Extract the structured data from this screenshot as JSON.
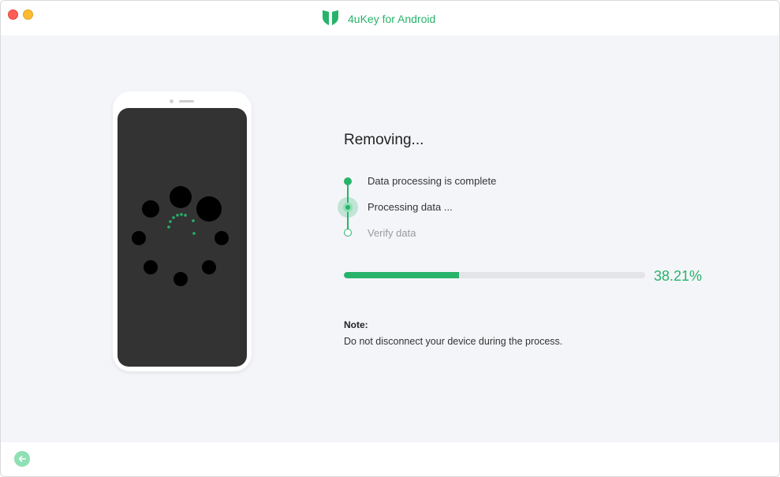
{
  "window": {
    "title": "4uKey for Android",
    "icon": "4ukey-shield-logo-icon",
    "controls": [
      "close",
      "minimize"
    ]
  },
  "status": {
    "heading": "Removing...",
    "steps": [
      {
        "label": "Data processing is complete",
        "state": "done"
      },
      {
        "label": "Processing data ...",
        "state": "active"
      },
      {
        "label": "Verify data",
        "state": "pending"
      }
    ],
    "progress_percent": 38.21,
    "progress_text": "38.21%"
  },
  "note": {
    "title": "Note:",
    "body": "Do not disconnect your device during the process."
  },
  "footer": {
    "back_icon": "back-arrow-icon"
  },
  "colors": {
    "accent": "#27b36a",
    "accent_light": "#8fe0b4",
    "track": "#e3e4e8",
    "phone_screen": "#333333"
  }
}
